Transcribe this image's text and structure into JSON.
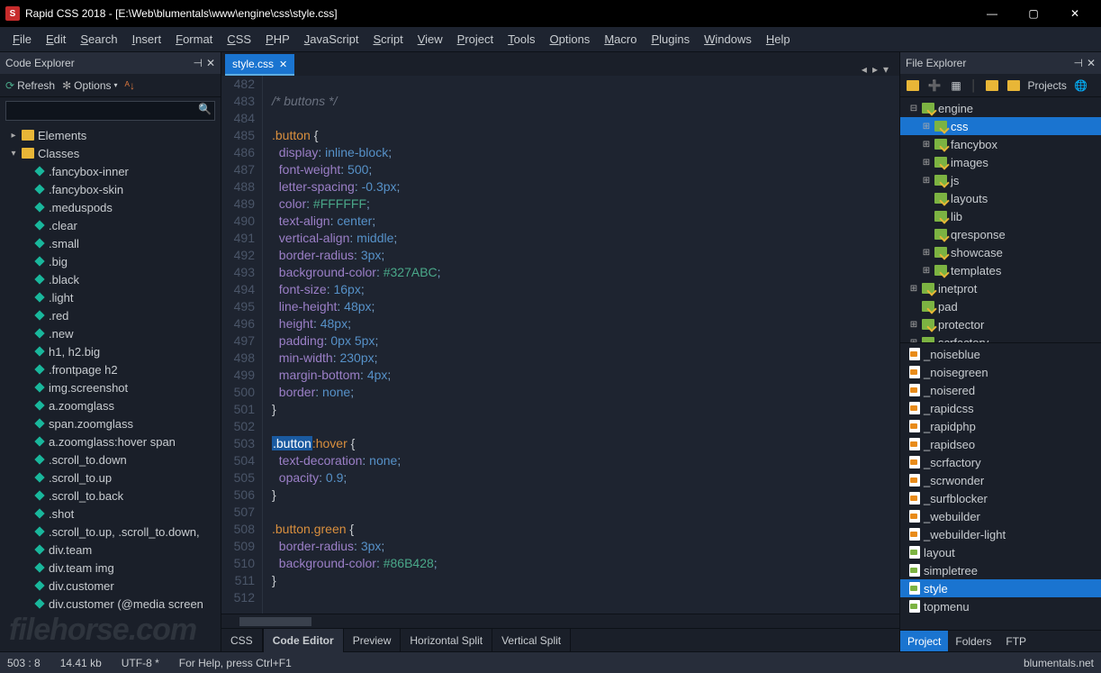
{
  "titlebar": {
    "app": "Rapid CSS 2018",
    "path": "[E:\\Web\\blumentals\\www\\engine\\css\\style.css]",
    "icon_letter": "S"
  },
  "menubar": [
    "File",
    "Edit",
    "Search",
    "Insert",
    "Format",
    "CSS",
    "PHP",
    "JavaScript",
    "Script",
    "View",
    "Project",
    "Tools",
    "Options",
    "Macro",
    "Plugins",
    "Windows",
    "Help"
  ],
  "code_explorer": {
    "title": "Code Explorer",
    "refresh": "Refresh",
    "options": "Options",
    "search_placeholder": "",
    "root_elements": "Elements",
    "root_classes": "Classes",
    "classes": [
      ".fancybox-inner",
      ".fancybox-skin",
      ".meduspods",
      ".clear",
      ".small",
      ".big",
      ".black",
      ".light",
      ".red",
      ".new",
      "h1, h2.big",
      ".frontpage h2",
      "img.screenshot",
      "a.zoomglass",
      "span.zoomglass",
      "a.zoomglass:hover span",
      ".scroll_to.down",
      ".scroll_to.up",
      ".scroll_to.back",
      ".shot",
      ".scroll_to.up, .scroll_to.down,",
      "div.team",
      "div.team img",
      "div.customer",
      "div.customer (@media screen"
    ]
  },
  "file_tab": {
    "name": "style.css"
  },
  "code": {
    "start": 482,
    "lines": [
      {
        "t": ""
      },
      {
        "t": "comment",
        "c": "/* buttons */"
      },
      {
        "t": ""
      },
      {
        "t": "sel",
        "s": ".button",
        "b": "{"
      },
      {
        "t": "prop",
        "p": "display",
        "v": "inline-block"
      },
      {
        "t": "prop",
        "p": "font-weight",
        "v": "500"
      },
      {
        "t": "prop",
        "p": "letter-spacing",
        "v": "-0.3px"
      },
      {
        "t": "propcol",
        "p": "color",
        "v": "#FFFFFF"
      },
      {
        "t": "prop",
        "p": "text-align",
        "v": "center"
      },
      {
        "t": "prop",
        "p": "vertical-align",
        "v": "middle"
      },
      {
        "t": "prop",
        "p": "border-radius",
        "v": "3px"
      },
      {
        "t": "propcol",
        "p": "background-color",
        "v": "#327ABC"
      },
      {
        "t": "prop",
        "p": "font-size",
        "v": "16px"
      },
      {
        "t": "prop",
        "p": "line-height",
        "v": "48px"
      },
      {
        "t": "prop",
        "p": "height",
        "v": "48px"
      },
      {
        "t": "prop2",
        "p": "padding",
        "v1": "0px",
        "v2": "5px"
      },
      {
        "t": "prop",
        "p": "min-width",
        "v": "230px"
      },
      {
        "t": "prop",
        "p": "margin-bottom",
        "v": "4px"
      },
      {
        "t": "prop",
        "p": "border",
        "v": "none"
      },
      {
        "t": "close"
      },
      {
        "t": ""
      },
      {
        "t": "selhl",
        "s1": ".button",
        "s2": ":hover",
        "b": "{"
      },
      {
        "t": "prop",
        "p": "text-decoration",
        "v": "none"
      },
      {
        "t": "prop",
        "p": "opacity",
        "v": "0.9"
      },
      {
        "t": "close"
      },
      {
        "t": ""
      },
      {
        "t": "sel",
        "s": ".button.green",
        "b": "{"
      },
      {
        "t": "prop",
        "p": "border-radius",
        "v": "3px"
      },
      {
        "t": "propcol",
        "p": "background-color",
        "v": "#86B428"
      },
      {
        "t": "close"
      },
      {
        "t": ""
      }
    ]
  },
  "view_tabs": {
    "lang": "CSS",
    "tabs": [
      "Code Editor",
      "Preview",
      "Horizontal Split",
      "Vertical Split"
    ],
    "active": 0
  },
  "file_explorer": {
    "title": "File Explorer",
    "projects_label": "Projects",
    "folders": [
      {
        "name": "engine",
        "d": 0,
        "exp": "-",
        "ico": "green"
      },
      {
        "name": "css",
        "d": 1,
        "exp": "+",
        "ico": "green",
        "sel": true
      },
      {
        "name": "fancybox",
        "d": 1,
        "exp": "+",
        "ico": "green"
      },
      {
        "name": "images",
        "d": 1,
        "exp": "+",
        "ico": "green"
      },
      {
        "name": "js",
        "d": 1,
        "exp": "+",
        "ico": "green"
      },
      {
        "name": "layouts",
        "d": 1,
        "exp": "",
        "ico": "green"
      },
      {
        "name": "lib",
        "d": 1,
        "exp": "",
        "ico": "green"
      },
      {
        "name": "qresponse",
        "d": 1,
        "exp": "",
        "ico": "green"
      },
      {
        "name": "showcase",
        "d": 1,
        "exp": "+",
        "ico": "green"
      },
      {
        "name": "templates",
        "d": 1,
        "exp": "+",
        "ico": "green"
      },
      {
        "name": "inetprot",
        "d": 0,
        "exp": "+",
        "ico": "green"
      },
      {
        "name": "pad",
        "d": 0,
        "exp": "",
        "ico": "green"
      },
      {
        "name": "protector",
        "d": 0,
        "exp": "+",
        "ico": "green"
      },
      {
        "name": "scrfactory",
        "d": 0,
        "exp": "+",
        "ico": "green"
      }
    ],
    "files": [
      {
        "name": "_noiseblue",
        "ico": "orange"
      },
      {
        "name": "_noisegreen",
        "ico": "orange"
      },
      {
        "name": "_noisered",
        "ico": "orange"
      },
      {
        "name": "_rapidcss",
        "ico": "orange"
      },
      {
        "name": "_rapidphp",
        "ico": "orange"
      },
      {
        "name": "_rapidseo",
        "ico": "orange"
      },
      {
        "name": "_scrfactory",
        "ico": "orange"
      },
      {
        "name": "_scrwonder",
        "ico": "orange"
      },
      {
        "name": "_surfblocker",
        "ico": "orange"
      },
      {
        "name": "_webuilder",
        "ico": "orange"
      },
      {
        "name": "_webuilder-light",
        "ico": "orange"
      },
      {
        "name": "layout",
        "ico": "green"
      },
      {
        "name": "simpletree",
        "ico": "green"
      },
      {
        "name": "style",
        "ico": "green",
        "sel": true
      },
      {
        "name": "topmenu",
        "ico": "green"
      }
    ],
    "bottom_tabs": [
      "Project",
      "Folders",
      "FTP"
    ],
    "bottom_active": 0
  },
  "statusbar": {
    "pos": "503 : 8",
    "size": "14.41 kb",
    "enc": "UTF-8 *",
    "hint": "For Help, press Ctrl+F1",
    "right": "blumentals.net"
  },
  "watermark": "filehorse.com"
}
